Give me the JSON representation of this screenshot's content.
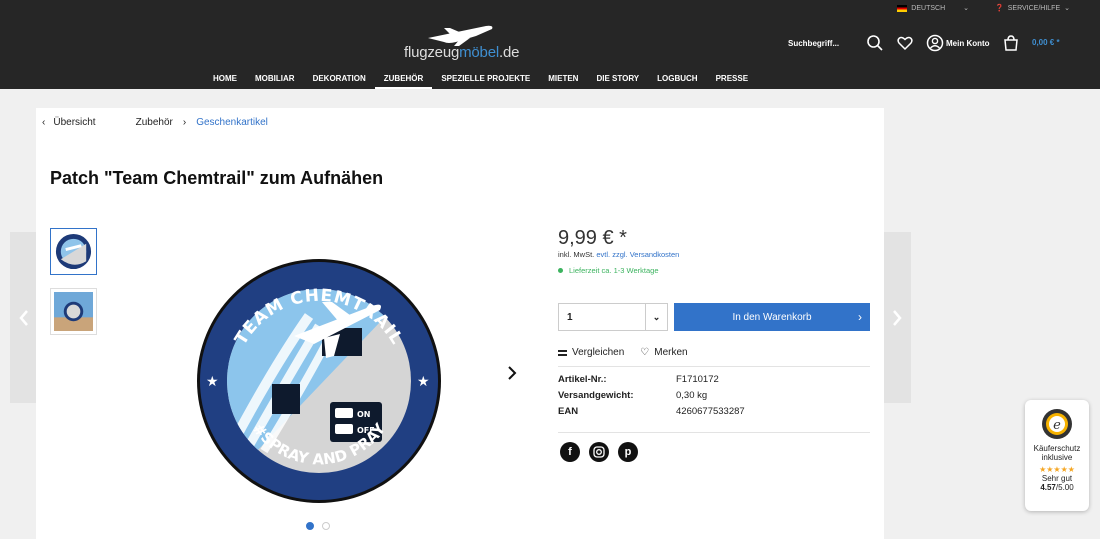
{
  "topbar": {
    "language": "DEUTSCH",
    "service": "SERVICE/HILFE"
  },
  "logo": {
    "part1": "flugzeug",
    "part2": "möbel",
    "part3": ".de"
  },
  "header": {
    "search_placeholder": "Suchbegriff...",
    "account": "Mein Konto",
    "cart_total": "0,00 € *"
  },
  "nav": [
    "HOME",
    "MOBILIAR",
    "DEKORATION",
    "ZUBEHÖR",
    "SPEZIELLE PROJEKTE",
    "MIETEN",
    "DIE STORY",
    "LOGBUCH",
    "PRESSE"
  ],
  "nav_active": "ZUBEHÖR",
  "breadcrumb": {
    "back": "Übersicht",
    "level1": "Zubehör",
    "level2": "Geschenkartikel"
  },
  "product": {
    "title": "Patch \"Team Chemtrail\" zum Aufnähen",
    "price": "9,99 € *",
    "tax_prefix": "inkl. MwSt.",
    "tax_link": "evtl. zzgl. Versandkosten",
    "delivery": "Lieferzeit ca. 1-3 Werktage",
    "quantity": "1",
    "add_to_cart": "In den Warenkorb",
    "compare": "Vergleichen",
    "wishlist": "Merken",
    "properties": [
      {
        "label": "Artikel-Nr.:",
        "value": "F1710172"
      },
      {
        "label": "Versandgewicht:",
        "value": "0,30 kg"
      },
      {
        "label": "EAN",
        "value": "4260677533287"
      }
    ]
  },
  "patch": {
    "top_text": "TEAM CHEMTRAIL",
    "bottom_text": "#SPRAY AND PRAY",
    "switch_on": "ON",
    "switch_off": "OFF"
  },
  "trust": {
    "line1": "Käuferschutz",
    "line2": "inklusive",
    "stars": "★★★★★",
    "rating_word": "Sehr gut",
    "score": "4.57",
    "score_max": "/5.00"
  },
  "colors": {
    "accent": "#3273c9",
    "header_bg": "#262626",
    "delivery_green": "#3cb35f"
  }
}
